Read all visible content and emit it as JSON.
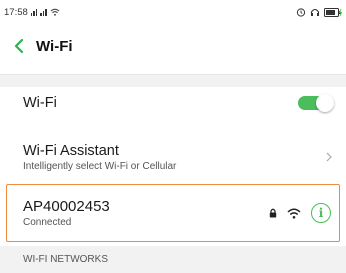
{
  "status_bar": {
    "time": "17:58",
    "icons": [
      "signal-icon",
      "signal-icon",
      "wifi-icon",
      "alarm-icon",
      "headphones-icon",
      "battery-icon"
    ]
  },
  "nav": {
    "title": "Wi-Fi",
    "back_icon": "chevron-left-icon"
  },
  "settings": {
    "wifi": {
      "label": "Wi-Fi",
      "enabled": true
    },
    "assistant": {
      "label": "Wi-Fi Assistant",
      "description": "Intelligently select Wi-Fi or Cellular"
    }
  },
  "connected_network": {
    "ssid": "AP40002453",
    "status": "Connected",
    "icons": [
      "lock-icon",
      "wifi-signal-icon",
      "info-icon"
    ]
  },
  "section": {
    "title": "WI-FI NETWORKS"
  },
  "colors": {
    "accent_green": "#4bbd5c",
    "highlight_border": "#f08a3c"
  }
}
